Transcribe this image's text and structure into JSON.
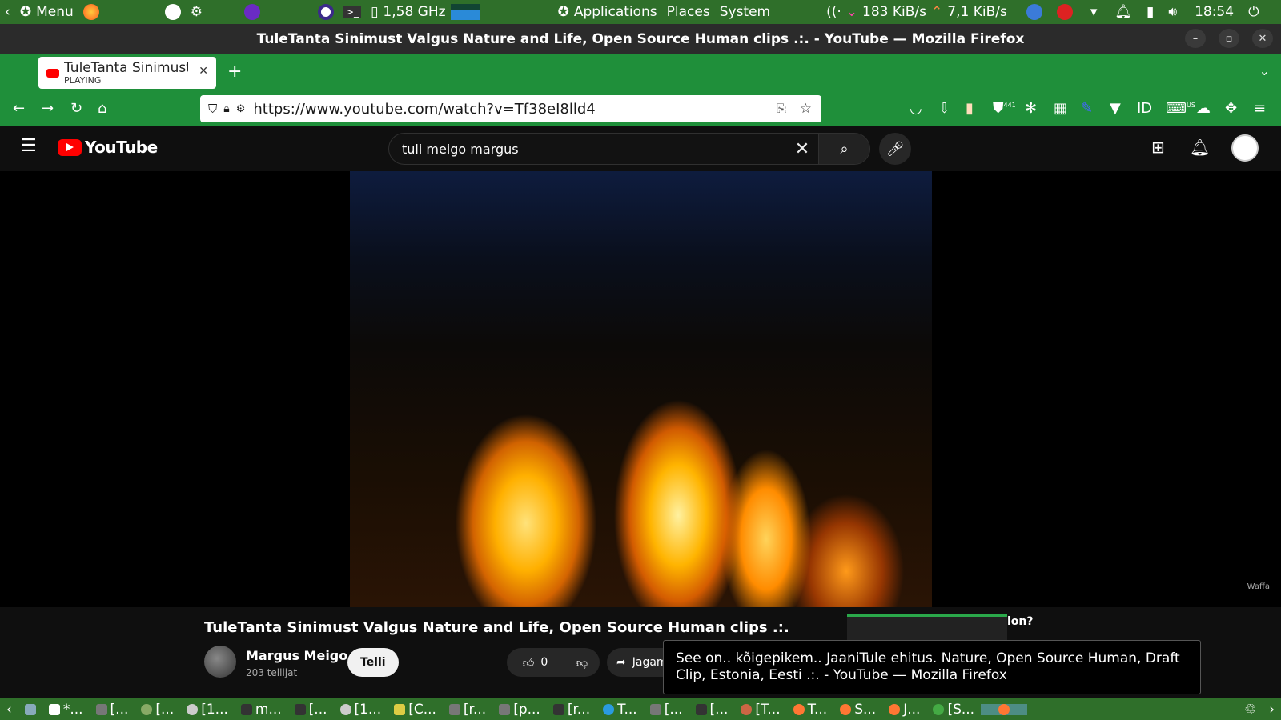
{
  "top_panel": {
    "menu_label": "Menu",
    "cpu_freq": "1,58 GHz",
    "applications": "Applications",
    "places": "Places",
    "system": "System",
    "net_down": "183 KiB/s",
    "net_up": "7,1 KiB/s",
    "clock": "18:54"
  },
  "window": {
    "title": "TuleTanta Sinimust Valgus Nature and Life, Open Source Human clips .:. - YouTube — Mozilla Firefox"
  },
  "browser": {
    "tab_title": "TuleTanta Sinimust Valgus",
    "tab_status": "PLAYING",
    "url": "https://www.youtube.com/watch?v=Tf38eI8lld4",
    "ext_badge": "441",
    "ext_badge2": "US"
  },
  "youtube": {
    "logo_text": "YouTube",
    "search_value": "tuli meigo margus"
  },
  "video": {
    "title": "TuleTanta Sinimust Valgus Nature and Life, Open Source Human clips .:.",
    "channel": "Margus Meigo",
    "subscribers": "203 tellijat",
    "subscribe_label": "Telli",
    "likes": "0",
    "share_label": "Jagame",
    "watermark": "Waffa"
  },
  "recommendation_snippet": "ion?",
  "tooltip": {
    "text": "See on.. kõigepikem.. JaaniTule ehitus. Nature, Open Source Human, Draft Clip, Estonia, Eesti .:. - YouTube — Mozilla Firefox"
  },
  "taskbar": {
    "items": [
      "*...",
      "[...",
      "[...",
      "[1...",
      "m...",
      "[...",
      "[1...",
      "[C...",
      "[r...",
      "[p...",
      "[r...",
      "T...",
      "[...",
      "[...",
      "[T...",
      "T...",
      "S...",
      "J...",
      "[S..."
    ]
  }
}
